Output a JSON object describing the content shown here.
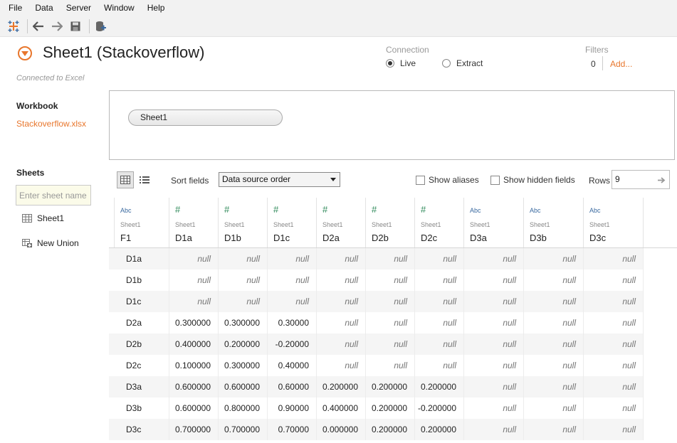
{
  "menu": [
    "File",
    "Data",
    "Server",
    "Window",
    "Help"
  ],
  "datasource": {
    "title": "Sheet1 (Stackoverflow)",
    "connected_text": "Connected to Excel"
  },
  "connection": {
    "label": "Connection",
    "live_label": "Live",
    "extract_label": "Extract",
    "selected": "Live"
  },
  "filters": {
    "label": "Filters",
    "count": "0",
    "add_label": "Add..."
  },
  "workbook": {
    "title": "Workbook",
    "file": "Stackoverflow.xlsx"
  },
  "sheets": {
    "title": "Sheets",
    "search_placeholder": "Enter sheet name",
    "items": [
      {
        "label": "Sheet1",
        "icon": "sheet-grid-icon"
      },
      {
        "label": "New Union",
        "icon": "union-icon"
      }
    ]
  },
  "canvas": {
    "pill_label": "Sheet1"
  },
  "grid_toolbar": {
    "sort_label": "Sort fields",
    "sort_value": "Data source order",
    "show_aliases": "Show aliases",
    "show_hidden": "Show hidden fields",
    "rows_label": "Rows",
    "rows_value": "9"
  },
  "table": {
    "columns": [
      {
        "type": "Abc",
        "source": "Sheet1",
        "name": "F1"
      },
      {
        "type": "#",
        "source": "Sheet1",
        "name": "D1a"
      },
      {
        "type": "#",
        "source": "Sheet1",
        "name": "D1b"
      },
      {
        "type": "#",
        "source": "Sheet1",
        "name": "D1c"
      },
      {
        "type": "#",
        "source": "Sheet1",
        "name": "D2a"
      },
      {
        "type": "#",
        "source": "Sheet1",
        "name": "D2b"
      },
      {
        "type": "#",
        "source": "Sheet1",
        "name": "D2c"
      },
      {
        "type": "Abc",
        "source": "Sheet1",
        "name": "D3a"
      },
      {
        "type": "Abc",
        "source": "Sheet1",
        "name": "D3b"
      },
      {
        "type": "Abc",
        "source": "Sheet1",
        "name": "D3c"
      }
    ],
    "rows": [
      [
        "D1a",
        "null",
        "null",
        "null",
        "null",
        "null",
        "null",
        "null",
        "null",
        "null"
      ],
      [
        "D1b",
        "null",
        "null",
        "null",
        "null",
        "null",
        "null",
        "null",
        "null",
        "null"
      ],
      [
        "D1c",
        "null",
        "null",
        "null",
        "null",
        "null",
        "null",
        "null",
        "null",
        "null"
      ],
      [
        "D2a",
        "0.300000",
        "0.300000",
        "0.30000",
        "null",
        "null",
        "null",
        "null",
        "null",
        "null"
      ],
      [
        "D2b",
        "0.400000",
        "0.200000",
        "-0.20000",
        "null",
        "null",
        "null",
        "null",
        "null",
        "null"
      ],
      [
        "D2c",
        "0.100000",
        "0.300000",
        "0.40000",
        "null",
        "null",
        "null",
        "null",
        "null",
        "null"
      ],
      [
        "D3a",
        "0.600000",
        "0.600000",
        "0.60000",
        "0.200000",
        "0.200000",
        "0.200000",
        "null",
        "null",
        "null"
      ],
      [
        "D3b",
        "0.600000",
        "0.800000",
        "0.90000",
        "0.400000",
        "0.200000",
        "-0.200000",
        "null",
        "null",
        "null"
      ],
      [
        "D3c",
        "0.700000",
        "0.700000",
        "0.70000",
        "0.000000",
        "0.200000",
        "0.200000",
        "null",
        "null",
        "null"
      ]
    ]
  },
  "colors": {
    "accent": "#e8762c",
    "string_type": "#3b6aa0",
    "number_type": "#2f8a5a"
  }
}
